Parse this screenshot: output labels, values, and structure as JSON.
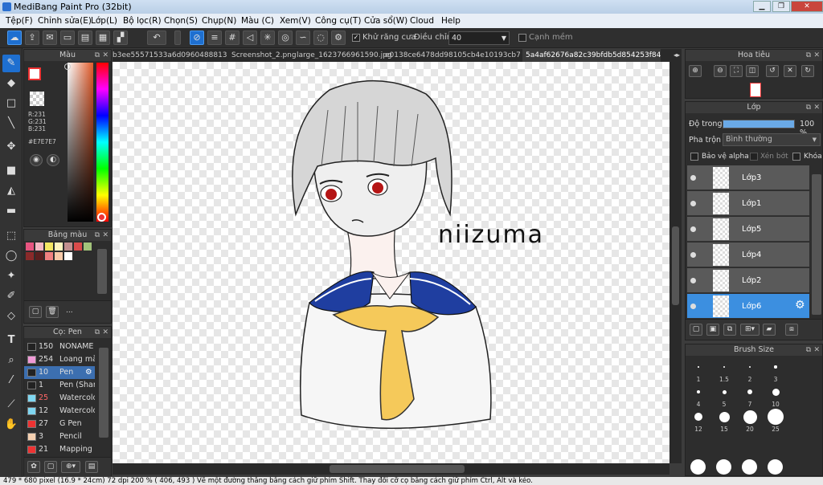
{
  "app": {
    "title": "MediBang Paint Pro (32bit)"
  },
  "menu": [
    "Tệp(F)",
    "Chỉnh sửa(E)",
    "Lớp(L)",
    "Bộ lọc(R)",
    "Chọn(S)",
    "Chụp(N)",
    "Màu (C)",
    "Xem(V)",
    "Công cụ(T)",
    "Cửa sổ(W)",
    "Cloud",
    "Help"
  ],
  "toolbar": {
    "antialias_label": "Khử răng cưa",
    "adjust_label": "Điều chỉnh",
    "adjust_value": "40",
    "soft_edge_label": "Cạnh mềm"
  },
  "tabs": [
    "b3ee55571533a6d09604888133.jpg",
    "Screenshot_2.png",
    "large_1623766961590.jpg",
    "e0138ce6478dd98105cb4e10193cb75e.jpg",
    "5a4af62676a82c39bfdb5d854253f841.jpg"
  ],
  "color_panel": {
    "title": "Màu",
    "r": "R:231",
    "g": "G:231",
    "b": "B:231",
    "hex": "#E7E7E7",
    "swatch_color": "#e7e7e7"
  },
  "palette_panel": {
    "title": "Bảng màu",
    "dots": "...",
    "colors": [
      "#e75480",
      "#f4b6c2",
      "#f5e663",
      "#fff5c0",
      "#c28f8f",
      "#d94a4a",
      "#a2c37a",
      "#8a2a2a",
      "#5a1f1f",
      "#f08080",
      "#f7c9a8",
      "#ffffff"
    ]
  },
  "brush_panel": {
    "title": "Cọ: Pen",
    "brushes": [
      {
        "size": "150",
        "name": "NONAME",
        "color": "#222"
      },
      {
        "size": "254",
        "name": "Loang màu",
        "color": "#f09ad6"
      },
      {
        "size": "10",
        "name": "Pen",
        "color": "#222",
        "active": true
      },
      {
        "size": "1",
        "name": "Pen (Sharp)",
        "color": "#222"
      },
      {
        "size": "25",
        "name": "Watercolor",
        "color": "#7fd6f0"
      },
      {
        "size": "12",
        "name": "Watercolor",
        "color": "#7fd6f0"
      },
      {
        "size": "27",
        "name": "G Pen",
        "color": "#e33"
      },
      {
        "size": "3",
        "name": "Pencil",
        "color": "#f5d0b0"
      },
      {
        "size": "21",
        "name": "Mapping P",
        "color": "#e33"
      }
    ]
  },
  "navigator_panel": {
    "title": "Hoa tiêu"
  },
  "layer_panel": {
    "title": "Lớp",
    "opacity_label": "Độ trong",
    "opacity_value": "100 %",
    "opacity_percent": 100,
    "blend_label": "Pha trộn",
    "blend_value": "Bình thường",
    "protect_alpha": "Bảo vệ alpha",
    "clipping": "Xén bớt",
    "lock": "Khóa",
    "layers": [
      {
        "name": "Lớp3"
      },
      {
        "name": "Lớp1"
      },
      {
        "name": "Lớp5"
      },
      {
        "name": "Lớp4"
      },
      {
        "name": "Lớp2"
      },
      {
        "name": "Lớp6",
        "active": true
      }
    ]
  },
  "brush_size_panel": {
    "title": "Brush Size",
    "sizes": [
      "1",
      "1.5",
      "2",
      "3",
      "4",
      "5",
      "7",
      "10",
      "12",
      "15",
      "20",
      "25"
    ]
  },
  "canvas": {
    "signature": "niizuma"
  },
  "status": "479 * 680 pixel  (16.9 * 24cm)  72 dpi  200 %  ( 406, 493 )  Vẽ một đường thẳng bằng cách giữ phím Shift. Thay đổi cỡ cọ bằng cách giữ phím Ctrl, Alt và kéo."
}
